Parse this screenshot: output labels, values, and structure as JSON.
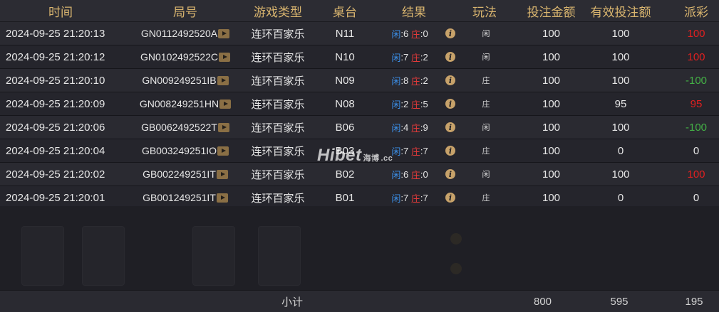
{
  "header": {
    "time": "时间",
    "round_id": "局号",
    "game_type": "游戏类型",
    "table": "桌台",
    "result": "结果",
    "play_type": "玩法",
    "bet_amount": "投注金额",
    "valid_bet": "有效投注额",
    "payout": "派彩"
  },
  "rows": [
    {
      "time": "2024-09-25 21:20:13",
      "round": "GN0112492520A",
      "game": "连环百家乐",
      "table": "N11",
      "p_label": "闲",
      "p_val": ":6",
      "b_label": "庄",
      "b_val": ":0",
      "bet_type": "闲",
      "bet": "100",
      "valid": "100",
      "payout": "100",
      "payout_class": "payout-pos"
    },
    {
      "time": "2024-09-25 21:20:12",
      "round": "GN0102492522C",
      "game": "连环百家乐",
      "table": "N10",
      "p_label": "闲",
      "p_val": ":7",
      "b_label": "庄",
      "b_val": ":2",
      "bet_type": "闲",
      "bet": "100",
      "valid": "100",
      "payout": "100",
      "payout_class": "payout-pos"
    },
    {
      "time": "2024-09-25 21:20:10",
      "round": "GN009249251IB",
      "game": "连环百家乐",
      "table": "N09",
      "p_label": "闲",
      "p_val": ":8",
      "b_label": "庄",
      "b_val": ":2",
      "bet_type": "庄",
      "bet": "100",
      "valid": "100",
      "payout": "-100",
      "payout_class": "payout-neg"
    },
    {
      "time": "2024-09-25 21:20:09",
      "round": "GN008249251HN",
      "game": "连环百家乐",
      "table": "N08",
      "p_label": "闲",
      "p_val": ":2",
      "b_label": "庄",
      "b_val": ":5",
      "bet_type": "庄",
      "bet": "100",
      "valid": "95",
      "payout": "95",
      "payout_class": "payout-pos"
    },
    {
      "time": "2024-09-25 21:20:06",
      "round": "GB0062492522T",
      "game": "连环百家乐",
      "table": "B06",
      "p_label": "闲",
      "p_val": ":4",
      "b_label": "庄",
      "b_val": ":9",
      "bet_type": "闲",
      "bet": "100",
      "valid": "100",
      "payout": "-100",
      "payout_class": "payout-neg"
    },
    {
      "time": "2024-09-25 21:20:04",
      "round": "GB003249251IO",
      "game": "连环百家乐",
      "table": "B03",
      "p_label": "闲",
      "p_val": ":7",
      "b_label": "庄",
      "b_val": ":7",
      "bet_type": "庄",
      "bet": "100",
      "valid": "0",
      "payout": "0",
      "payout_class": "payout-zero"
    },
    {
      "time": "2024-09-25 21:20:02",
      "round": "GB002249251IT",
      "game": "连环百家乐",
      "table": "B02",
      "p_label": "闲",
      "p_val": ":6",
      "b_label": "庄",
      "b_val": ":0",
      "bet_type": "闲",
      "bet": "100",
      "valid": "100",
      "payout": "100",
      "payout_class": "payout-pos"
    },
    {
      "time": "2024-09-25 21:20:01",
      "round": "GB001249251IT",
      "game": "连环百家乐",
      "table": "B01",
      "p_label": "闲",
      "p_val": ":7",
      "b_label": "庄",
      "b_val": ":7",
      "bet_type": "庄",
      "bet": "100",
      "valid": "0",
      "payout": "0",
      "payout_class": "payout-zero"
    }
  ],
  "footer": {
    "label": "小计",
    "bet_total": "800",
    "valid_total": "595",
    "payout_total": "195"
  },
  "watermark": {
    "brand": "Hibet",
    "sub": "海博",
    "suffix": ".cc"
  },
  "colors": {
    "header_text": "#d9b56f",
    "player": "#3b8fe8",
    "banker": "#e23a3a",
    "win": "#e02020",
    "loss": "#44b046"
  },
  "icons": {
    "replay": "play-icon",
    "details": "info-icon"
  }
}
